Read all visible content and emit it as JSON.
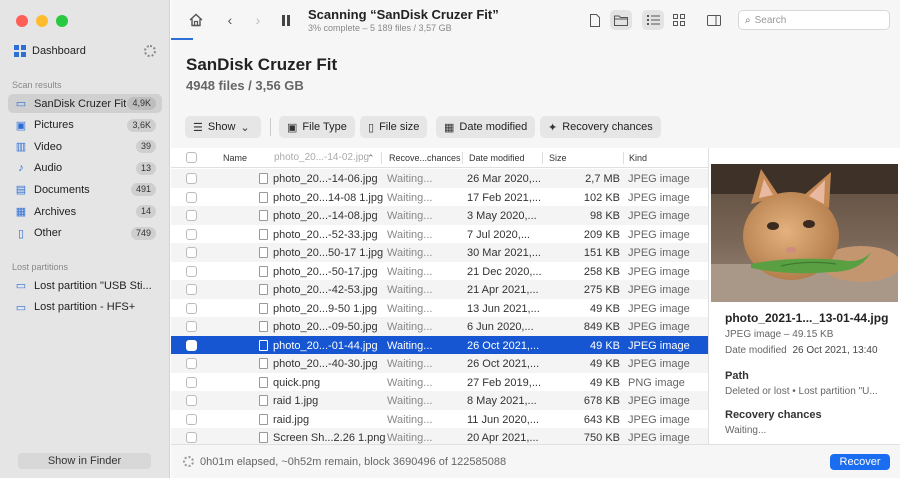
{
  "window": {
    "traffic_colors": [
      "#fe5f57",
      "#febc2e",
      "#28c840"
    ]
  },
  "sidebar": {
    "dashboard_label": "Dashboard",
    "scan_results_title": "Scan results",
    "items": [
      {
        "label": "SanDisk Cruzer Fit",
        "badge": "4,9K",
        "icon": "drive-icon"
      },
      {
        "label": "Pictures",
        "badge": "3,6K",
        "icon": "picture-icon"
      },
      {
        "label": "Video",
        "badge": "39",
        "icon": "video-icon"
      },
      {
        "label": "Audio",
        "badge": "13",
        "icon": "music-note-icon"
      },
      {
        "label": "Documents",
        "badge": "491",
        "icon": "document-icon"
      },
      {
        "label": "Archives",
        "badge": "14",
        "icon": "archive-icon"
      },
      {
        "label": "Other",
        "badge": "749",
        "icon": "other-icon"
      }
    ],
    "lost_partitions_title": "Lost partitions",
    "lost": [
      {
        "label": "Lost partition \"USB Sti...",
        "icon": "drive-icon"
      },
      {
        "label": "Lost partition - HFS+",
        "icon": "drive-icon"
      }
    ],
    "show_in_finder": "Show in Finder"
  },
  "toolbar": {
    "title": "Scanning “SanDisk Cruzer Fit”",
    "subtitle": "3% complete – 5 189 files / 3,57 GB",
    "progress_fraction": 0.03,
    "search_placeholder": "Search"
  },
  "header": {
    "drive_title": "SanDisk Cruzer Fit",
    "drive_sub": "4948 files / 3,56 GB",
    "filters": [
      "Show",
      "File Type",
      "File size",
      "Date modified",
      "Recovery chances"
    ]
  },
  "table": {
    "columns": {
      "name": "Name",
      "recovery": "Recove...chances",
      "date": "Date modified",
      "size": "Size",
      "kind": "Kind"
    },
    "ghost_name": "photo_20...-14-02.jpg",
    "rows": [
      {
        "name": "photo_20...-14-06.jpg",
        "rec": "Waiting...",
        "date": "26 Mar 2020,...",
        "size": "2,7 MB",
        "kind": "JPEG image"
      },
      {
        "name": "photo_20...14-08 1.jpg",
        "rec": "Waiting...",
        "date": "17 Feb 2021,...",
        "size": "102 KB",
        "kind": "JPEG image"
      },
      {
        "name": "photo_20...-14-08.jpg",
        "rec": "Waiting...",
        "date": "3 May 2020,...",
        "size": "98 KB",
        "kind": "JPEG image"
      },
      {
        "name": "photo_20...-52-33.jpg",
        "rec": "Waiting...",
        "date": "7 Jul 2020,...",
        "size": "209 KB",
        "kind": "JPEG image"
      },
      {
        "name": "photo_20...50-17 1.jpg",
        "rec": "Waiting...",
        "date": "30 Mar 2021,...",
        "size": "151 KB",
        "kind": "JPEG image"
      },
      {
        "name": "photo_20...-50-17.jpg",
        "rec": "Waiting...",
        "date": "21 Dec 2020,...",
        "size": "258 KB",
        "kind": "JPEG image"
      },
      {
        "name": "photo_20...-42-53.jpg",
        "rec": "Waiting...",
        "date": "21 Apr 2021,...",
        "size": "275 KB",
        "kind": "JPEG image"
      },
      {
        "name": "photo_20...9-50 1.jpg",
        "rec": "Waiting...",
        "date": "13 Jun 2021,...",
        "size": "49 KB",
        "kind": "JPEG image"
      },
      {
        "name": "photo_20...-09-50.jpg",
        "rec": "Waiting...",
        "date": "6 Jun 2020,...",
        "size": "849 KB",
        "kind": "JPEG image"
      },
      {
        "name": "photo_20...-01-44.jpg",
        "rec": "Waiting...",
        "date": "26 Oct 2021,...",
        "size": "49 KB",
        "kind": "JPEG image",
        "selected": true
      },
      {
        "name": "photo_20...-40-30.jpg",
        "rec": "Waiting...",
        "date": "26 Oct 2021,...",
        "size": "49 KB",
        "kind": "JPEG image"
      },
      {
        "name": "quick.png",
        "rec": "Waiting...",
        "date": "27 Feb 2019,...",
        "size": "49 KB",
        "kind": "PNG image"
      },
      {
        "name": "raid 1.jpg",
        "rec": "Waiting...",
        "date": "8 May 2021,...",
        "size": "678 KB",
        "kind": "JPEG image"
      },
      {
        "name": "raid.jpg",
        "rec": "Waiting...",
        "date": "11 Jun 2020,...",
        "size": "643 KB",
        "kind": "JPEG image"
      },
      {
        "name": "Screen Sh...2.26 1.png",
        "rec": "Waiting...",
        "date": "20 Apr 2021,...",
        "size": "750 KB",
        "kind": "JPEG image"
      }
    ]
  },
  "preview": {
    "name": "photo_2021-1..._13-01-44.jpg",
    "type_size": "JPEG image – 49.15 KB",
    "date_label": "Date modified",
    "date_value": "26 Oct 2021, 13:40",
    "path_title": "Path",
    "path_value": "Deleted or lost • Lost partition \"U...",
    "recovery_title": "Recovery chances",
    "recovery_value": "Waiting..."
  },
  "status": {
    "text": "0h01m elapsed, ~0h52m remain, block 3690496 of 122585088",
    "recover_label": "Recover"
  }
}
